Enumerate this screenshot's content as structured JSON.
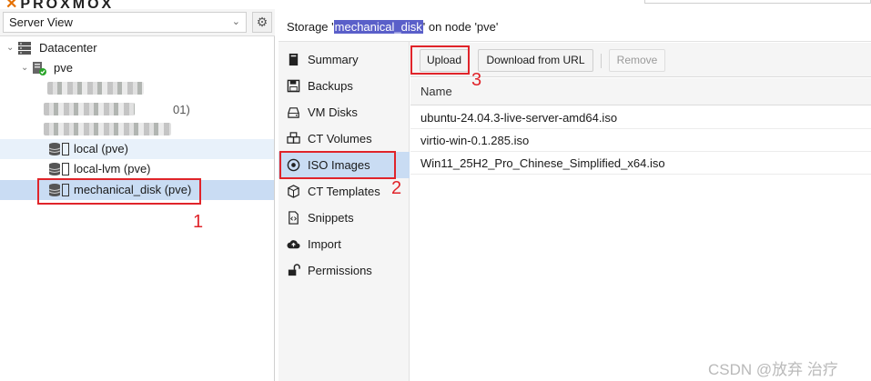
{
  "top": {
    "logo_fragment": "PROXMOX"
  },
  "sidebar": {
    "view_select": "Server View",
    "tree": {
      "datacenter": "Datacenter",
      "node": "pve",
      "storages": [
        {
          "label": "local (pve)"
        },
        {
          "label": "local-lvm (pve)"
        },
        {
          "label": "mechanical_disk (pve)"
        }
      ],
      "blurred_fragment": "01)"
    }
  },
  "header": {
    "prefix": "Storage '",
    "storage_name": "mechanical_disk",
    "suffix": "' on node 'pve'"
  },
  "nav": {
    "items": [
      {
        "label": "Summary",
        "icon": "book-icon"
      },
      {
        "label": "Backups",
        "icon": "floppy-icon"
      },
      {
        "label": "VM Disks",
        "icon": "hdd-icon"
      },
      {
        "label": "CT Volumes",
        "icon": "cubes-icon"
      },
      {
        "label": "ISO Images",
        "icon": "dot-circle-icon"
      },
      {
        "label": "CT Templates",
        "icon": "cube-icon"
      },
      {
        "label": "Snippets",
        "icon": "file-code-icon"
      },
      {
        "label": "Import",
        "icon": "cloud-upload-icon"
      },
      {
        "label": "Permissions",
        "icon": "unlock-icon"
      }
    ],
    "active": "ISO Images"
  },
  "toolbar": {
    "upload": "Upload",
    "download_url": "Download from URL",
    "remove": "Remove"
  },
  "grid": {
    "column_name": "Name",
    "rows": [
      "ubuntu-24.04.3-live-server-amd64.iso",
      "virtio-win-0.1.285.iso",
      "Win11_25H2_Pro_Chinese_Simplified_x64.iso"
    ]
  },
  "annotations": {
    "n1": "1",
    "n2": "2",
    "n3": "3"
  },
  "watermark": "CSDN @放弃      治疗",
  "colors": {
    "accent_red": "#e0242a",
    "selection": "#c9dcf3",
    "highlight": "#5a5fc9",
    "brand_orange": "#e57000"
  }
}
